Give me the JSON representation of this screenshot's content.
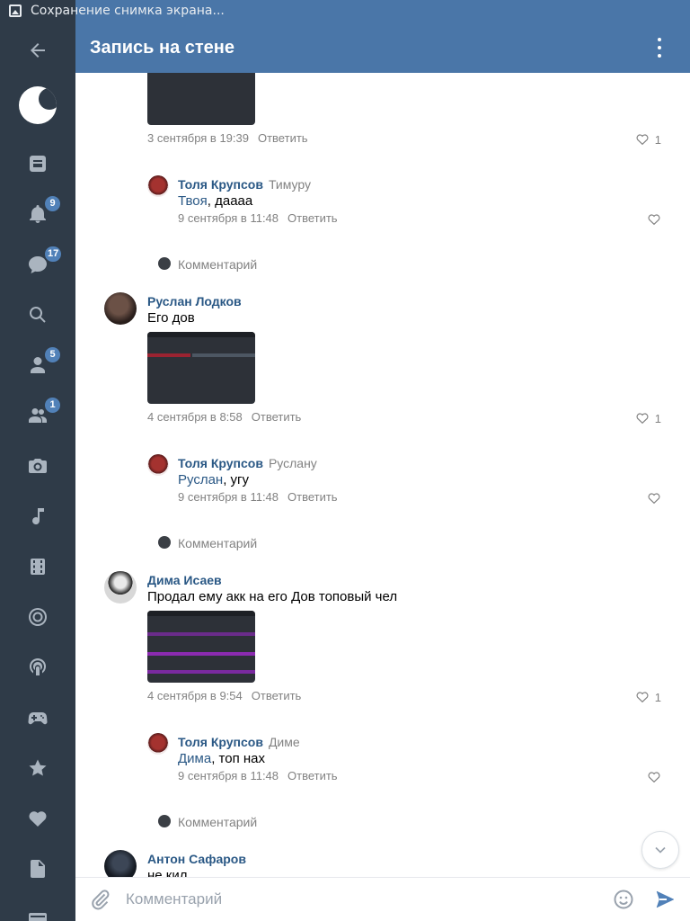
{
  "status_bar": {
    "text": "Сохранение снимка экрана..."
  },
  "header": {
    "title": "Запись на стене"
  },
  "sidebar": {
    "badges": {
      "notifications": "9",
      "messages": "17",
      "friends": "5",
      "groups": "1"
    }
  },
  "comments": [
    {
      "meta": {
        "date": "3 сентября в 19:39",
        "reply": "Ответить",
        "likes": "1"
      }
    },
    {
      "author": "Толя Крупсов",
      "reply_to": "Тимуру",
      "mention": "Твоя",
      "text": ", даааа",
      "date": "9 сентября в 11:48",
      "reply": "Ответить"
    },
    {
      "add_comment": "Комментарий"
    },
    {
      "author": "Руслан Лодков",
      "text": "Его дов",
      "date": "4 сентября в 8:58",
      "reply": "Ответить",
      "likes": "1"
    },
    {
      "author": "Толя Крупсов",
      "reply_to": "Руслану",
      "mention": "Руслан",
      "text": ", угу",
      "date": "9 сентября в 11:48",
      "reply": "Ответить"
    },
    {
      "add_comment": "Комментарий"
    },
    {
      "author": "Дима Исаев",
      "text": "Продал ему акк на его Дов топовый чел",
      "date": "4 сентября в 9:54",
      "reply": "Ответить",
      "likes": "1"
    },
    {
      "author": "Толя Крупсов",
      "reply_to": "Диме",
      "mention": "Дима",
      "text": ", топ нах",
      "date": "9 сентября в 11:48",
      "reply": "Ответить"
    },
    {
      "add_comment": "Комментарий"
    },
    {
      "author": "Антон Сафаров",
      "text": "не кил"
    }
  ],
  "composer": {
    "placeholder": "Комментарий"
  },
  "colors": {
    "header": "#4a76a8",
    "sidebar": "#2f3b48",
    "link": "#2a5885",
    "muted": "#828282",
    "badge": "#5181b8"
  }
}
